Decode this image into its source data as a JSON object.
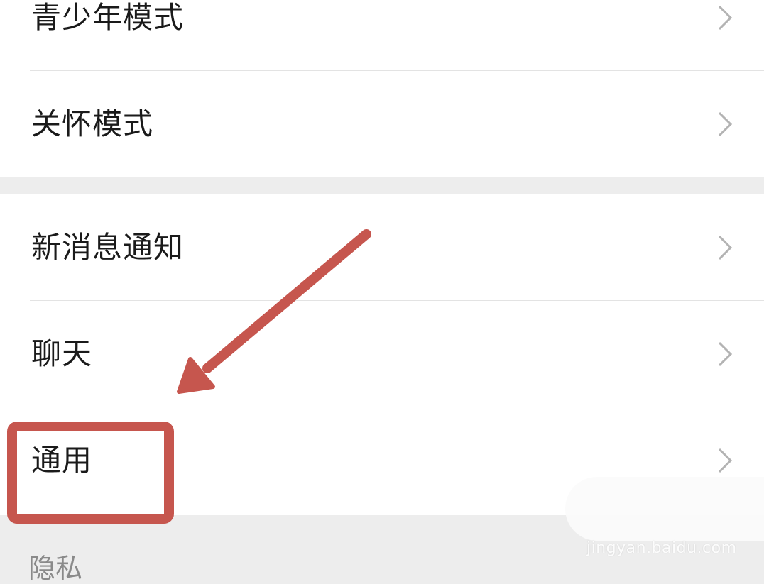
{
  "settings": {
    "group1": [
      {
        "label": "青少年模式"
      },
      {
        "label": "关怀模式"
      }
    ],
    "group2": [
      {
        "label": "新消息通知"
      },
      {
        "label": "聊天"
      },
      {
        "label": "通用"
      }
    ],
    "next_section_label": "隐私"
  },
  "annotation": {
    "highlight_color": "#c6564e",
    "arrow_color": "#c6564e"
  },
  "watermark": {
    "text": "jingyan.baidu.com"
  },
  "icons": {
    "chevron": "chevron-right-icon"
  },
  "colors": {
    "background": "#ededed",
    "card": "#ffffff",
    "text": "#1a1a1a",
    "chevron": "#b3b3b3",
    "divider": "#e3e3e3"
  }
}
